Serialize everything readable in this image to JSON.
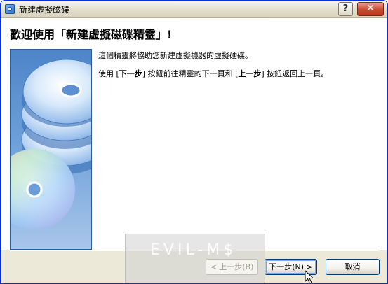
{
  "titlebar": {
    "title": "新建虛擬磁碟",
    "help_label": "?",
    "close_label": "✕"
  },
  "header": {
    "title": "歡迎使用「新建虛擬磁碟精靈」!"
  },
  "content": {
    "line1": "這個精靈將協助您新建虛擬機器的虛擬硬碟。",
    "line2_prefix": "使用 [",
    "next_ref": "下一步",
    "line2_mid": "] 按鈕前往精靈的下一頁和 [",
    "back_ref": "上一步",
    "line2_suffix": "] 按鈕返回上一頁。"
  },
  "buttons": {
    "back_label": "< 上一步(B)",
    "next_label": "下一步(N) >",
    "cancel_label": "取消"
  },
  "watermark": {
    "text": "EVIL-M$"
  }
}
